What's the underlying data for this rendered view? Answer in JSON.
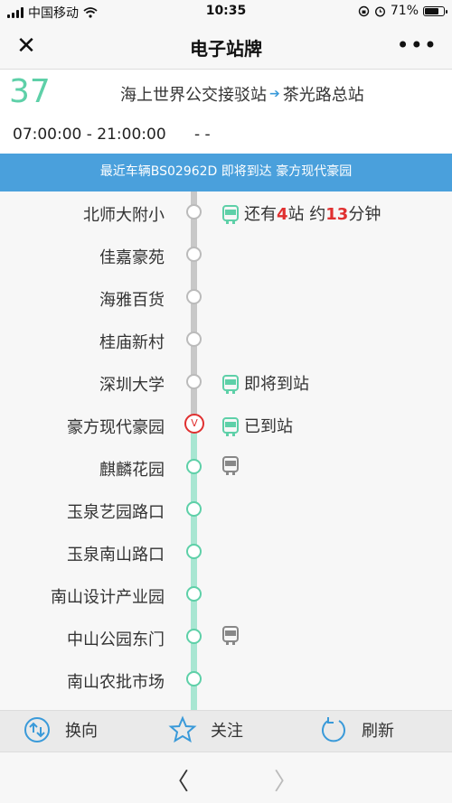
{
  "status_bar": {
    "carrier": "中国移动",
    "time": "10:35",
    "battery": "71%"
  },
  "nav_bar": {
    "close_icon": "✕",
    "title": "电子站牌",
    "more_icon": "•••"
  },
  "route": {
    "number": "37",
    "from": "海上世界公交接驳站",
    "arrow": "➔",
    "to": "茶光路总站",
    "hours": "07:00:00 - 21:00:00",
    "hours_extra": "- -"
  },
  "notice": "最近车辆BS02962D 即将到达 豪方现代豪园",
  "stops": [
    {
      "name": "北师大附小",
      "bus_prefix": "还有",
      "bus_stops": "4",
      "bus_mid": "站 约",
      "bus_min": "13",
      "bus_suffix": "分钟"
    },
    {
      "name": "佳嘉豪苑"
    },
    {
      "name": "海雅百货"
    },
    {
      "name": "桂庙新村"
    },
    {
      "name": "深圳大学",
      "bus_text": "即将到站"
    },
    {
      "name": "豪方现代豪园",
      "bus_text": "已到站",
      "current_marker": "V"
    },
    {
      "name": "麒麟花园"
    },
    {
      "name": "玉泉艺园路口"
    },
    {
      "name": "玉泉南山路口"
    },
    {
      "name": "南山设计产业园"
    },
    {
      "name": "中山公园东门"
    },
    {
      "name": "南山农批市场"
    }
  ],
  "toolbar": {
    "swap_label": "换向",
    "follow_label": "关注",
    "refresh_label": "刷新"
  },
  "bottom_nav": {
    "back_icon": "〈",
    "forward_icon": "〉"
  },
  "colors": {
    "accent_green": "#5ed0a8",
    "notice_blue": "#4aa0dc",
    "alert_red": "#e03030"
  }
}
